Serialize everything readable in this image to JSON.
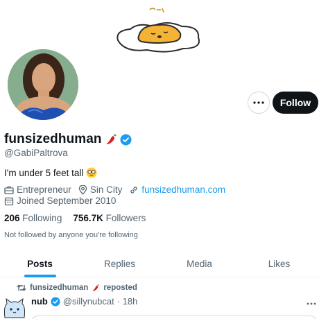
{
  "profile": {
    "display_name": "funsizedhuman",
    "handle": "@GabiPaltrova",
    "bio": "I'm under 5 feet tall",
    "verified": true,
    "name_emoji": "chili-pepper-icon",
    "bio_emoji": "nerd-face-icon"
  },
  "meta": {
    "occupation": "Entrepreneur",
    "location": "Sin City",
    "website": "funsizedhuman.com",
    "joined": "Joined September 2010"
  },
  "counts": {
    "following_value": "206",
    "following_label": "Following",
    "followers_value": "756.7K",
    "followers_label": "Followers"
  },
  "not_followed_text": "Not followed by anyone you're following",
  "actions": {
    "follow_label": "Follow"
  },
  "tabs": [
    {
      "label": "Posts",
      "active": true
    },
    {
      "label": "Replies",
      "active": false
    },
    {
      "label": "Media",
      "active": false
    },
    {
      "label": "Likes",
      "active": false
    }
  ],
  "post": {
    "repost_name": "funsizedhuman",
    "repost_text": "reposted",
    "author_name": "nub",
    "author_handle": "@sillynubcat",
    "time": "· 18h"
  },
  "colors": {
    "accent": "#1d9bf0",
    "text_primary": "#0f1419",
    "text_secondary": "#536471",
    "follow_bg": "#0f1419"
  }
}
